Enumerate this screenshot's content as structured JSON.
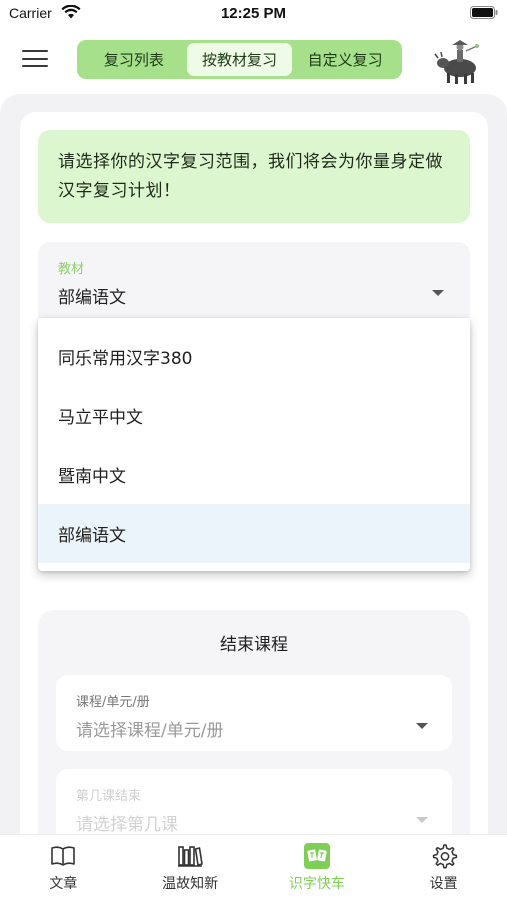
{
  "status_bar": {
    "carrier": "Carrier",
    "time": "12:25 PM"
  },
  "header": {
    "menu_icon": "hamburger-menu-icon",
    "tabs": [
      {
        "label": "复习列表",
        "active": false
      },
      {
        "label": "按教材复习",
        "active": true
      },
      {
        "label": "自定义复习",
        "active": false
      }
    ],
    "avatar_icon": "avatar"
  },
  "intro": {
    "text": "请选择你的汉字复习范围，我们将会为你量身定做汉字复习计划！"
  },
  "textbook_select": {
    "label": "教材",
    "value": "部编语文",
    "options": [
      {
        "label": "同乐常用汉字380",
        "selected": false
      },
      {
        "label": "马立平中文",
        "selected": false
      },
      {
        "label": "暨南中文",
        "selected": false
      },
      {
        "label": "部编语文",
        "selected": true
      }
    ]
  },
  "end_section": {
    "title": "结束课程",
    "fields": [
      {
        "label": "课程/单元/册",
        "placeholder": "请选择课程/单元/册"
      },
      {
        "label": "第几课结束",
        "placeholder": "请选择第几课"
      }
    ]
  },
  "tab_bar": {
    "items": [
      {
        "label": "文章",
        "icon": "book-open-icon",
        "active": false
      },
      {
        "label": "温故知新",
        "icon": "bookshelf-icon",
        "active": false
      },
      {
        "label": "识字快车",
        "icon": "flashcards-icon",
        "active": true
      },
      {
        "label": "设置",
        "icon": "gear-icon",
        "active": false
      }
    ]
  },
  "colors": {
    "accent_green": "#a7e08a",
    "intro_bg": "#dcf7cf",
    "active_tab_label": "#7fcf57",
    "selected_option_bg": "#ebf3fb"
  }
}
